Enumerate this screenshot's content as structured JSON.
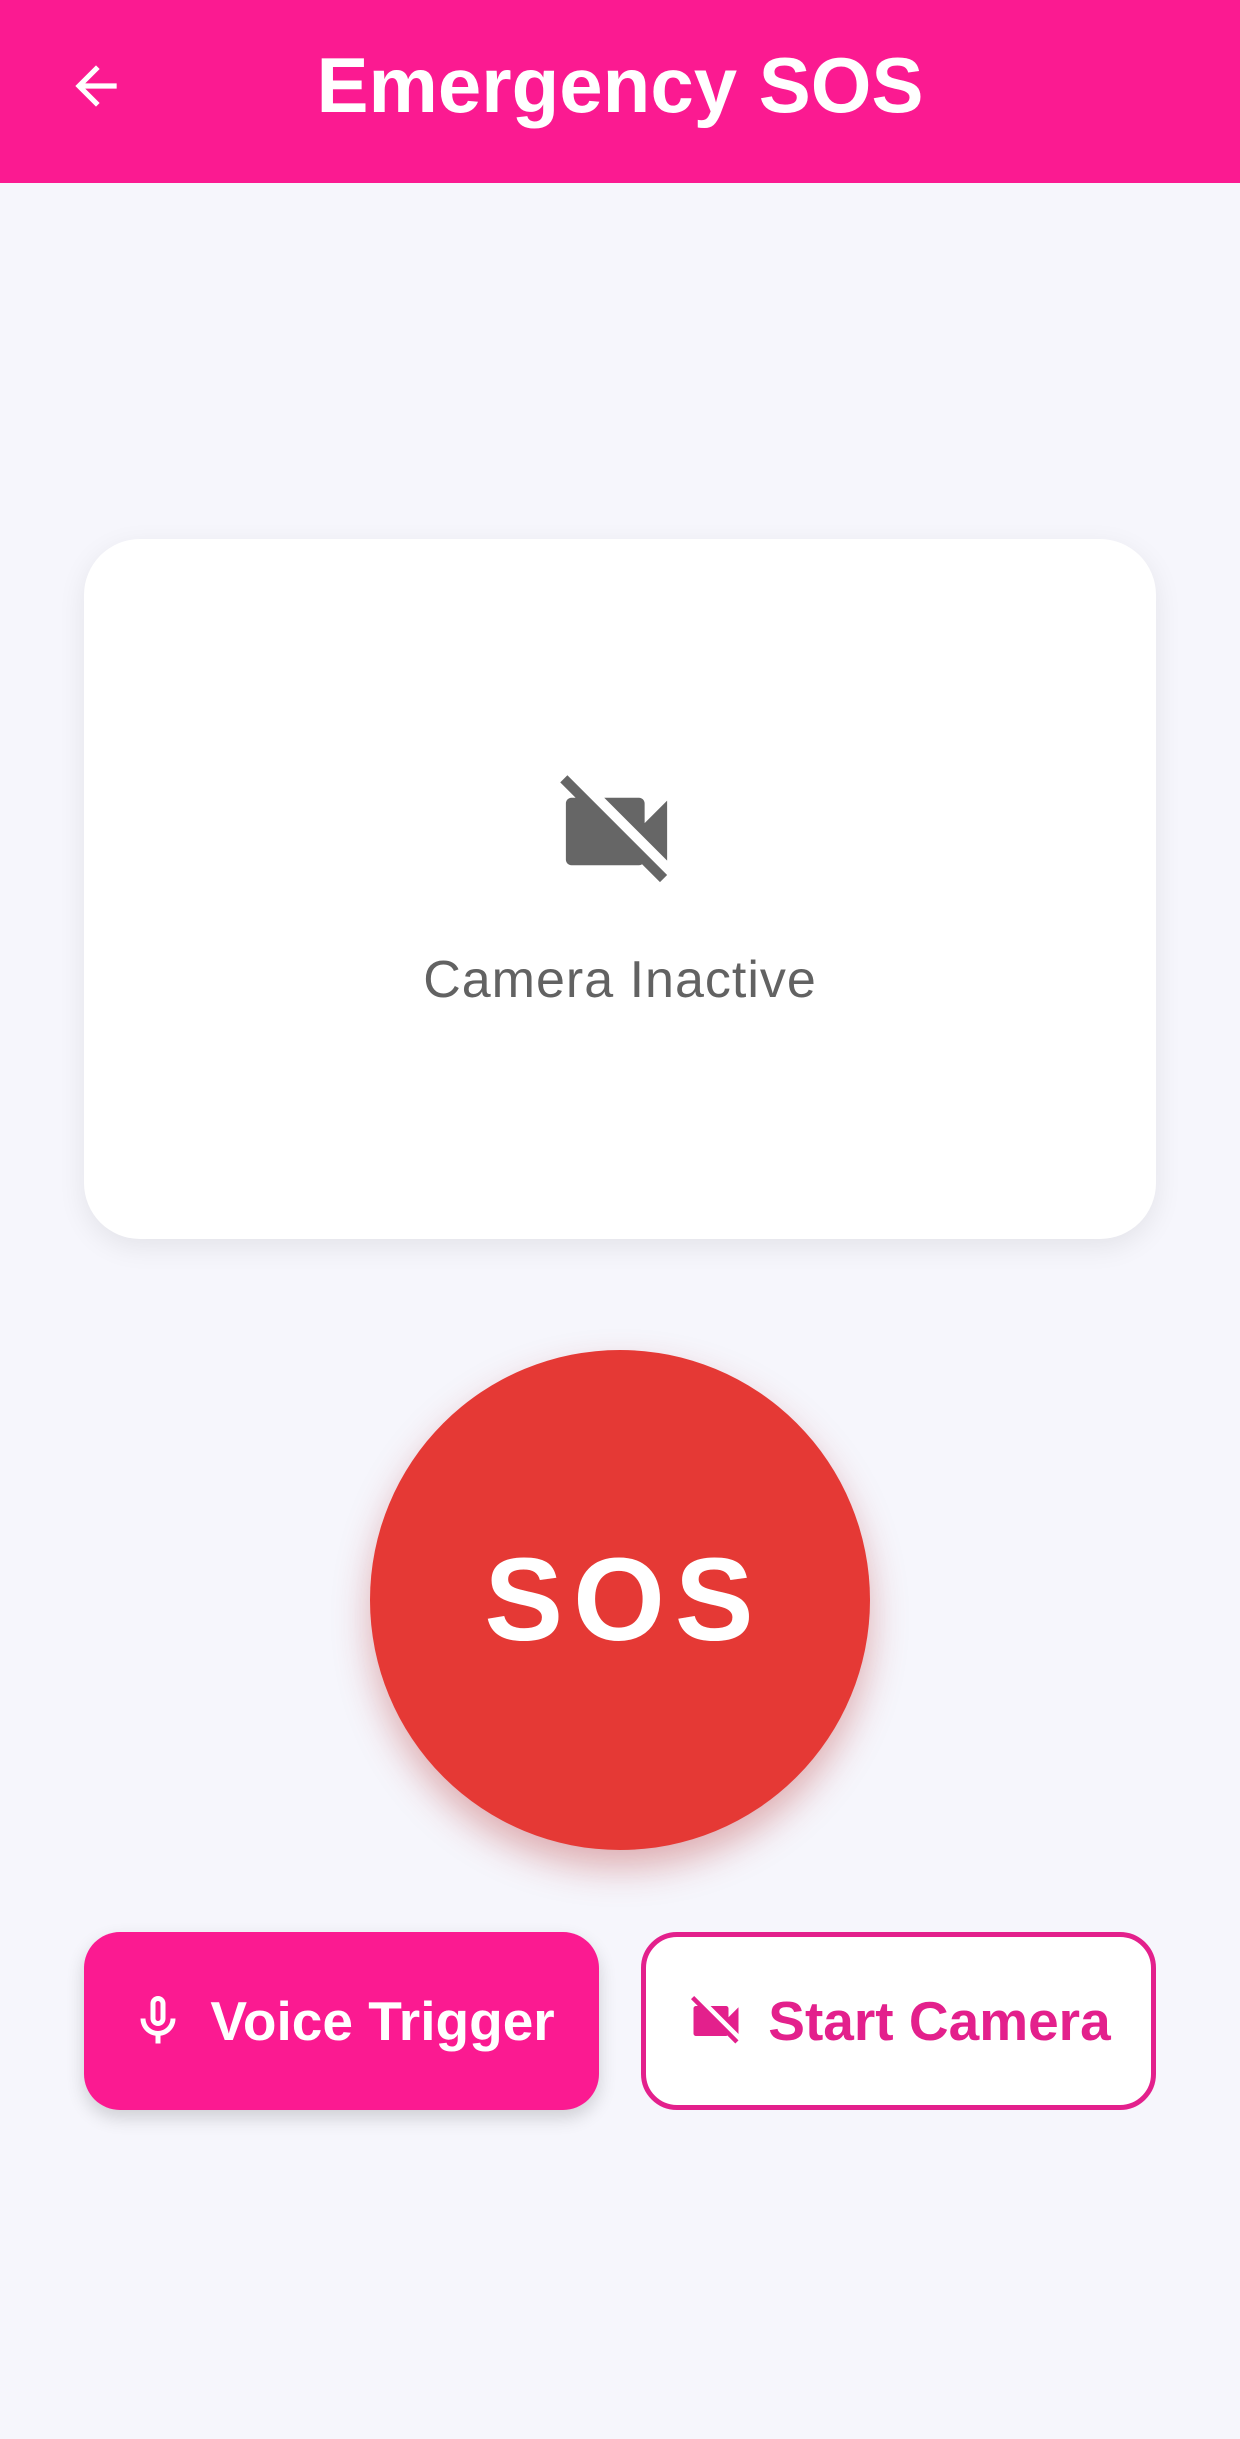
{
  "app_bar": {
    "title": "Emergency SOS",
    "back_icon": "arrow-back-icon",
    "background_color": "#fb1a91"
  },
  "camera_preview": {
    "icon": "videocam-off-icon",
    "status_text": "Camera Inactive"
  },
  "sos_button": {
    "label": "SOS",
    "color": "#e53935"
  },
  "actions": {
    "voice_trigger": {
      "label": "Voice Trigger",
      "icon": "microphone-icon"
    },
    "start_camera": {
      "label": "Start Camera",
      "icon": "videocam-off-icon"
    }
  }
}
